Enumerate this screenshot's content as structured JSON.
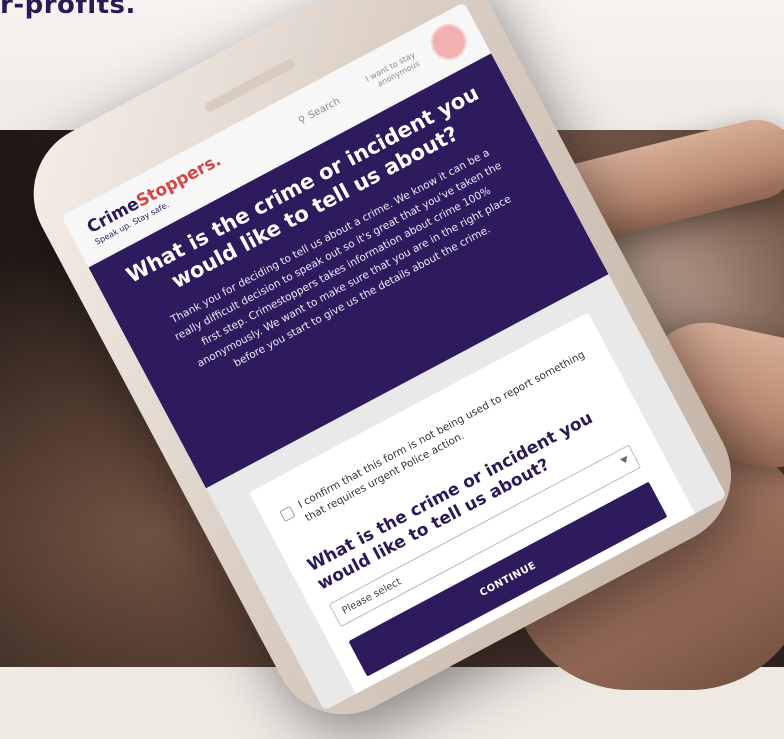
{
  "banner": {
    "headline_fragment": "r-profits."
  },
  "app": {
    "logo_crime": "Crime",
    "logo_stoppers": "Stoppers.",
    "logo_tagline": "Speak up. Stay safe.",
    "search_label": "Search",
    "anonymous_label": "I want to stay anonymous"
  },
  "hero": {
    "title": "What is the crime or incident you would like to tell us about?",
    "body": "Thank you for deciding to tell us about a crime. We know it can be a really difficult decision to speak out so it's great that you've taken the first step. Crimestoppers takes information about crime 100% anonymously. We want to make sure that you are in the right place before you start to give us the details about the crime."
  },
  "form": {
    "confirm_text": "I confirm that this form is not being used to report something that requires urgent Police action.",
    "question": "What is the crime or incident you would like to tell us about?",
    "select_value": "Please select",
    "continue_label": "CONTINUE"
  },
  "colors": {
    "brand_purple": "#2e1b5e",
    "brand_red": "#d64545"
  }
}
